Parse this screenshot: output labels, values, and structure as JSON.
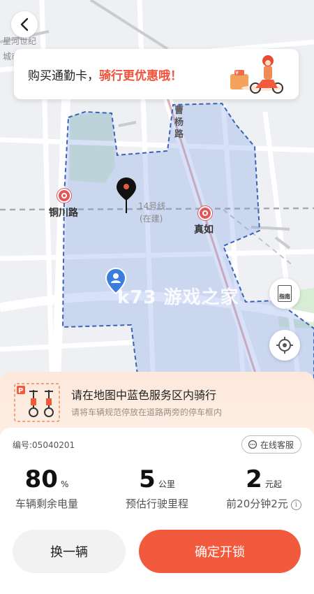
{
  "map": {
    "top_left_labels": [
      "星河世纪",
      "城市"
    ],
    "road_caoyang": "曹杨路",
    "station_tongchuan": "铜川路",
    "station_zhenru": "真如",
    "line14": "14号线",
    "line14_status": "(在建)",
    "watermark": "k73 游戏之家",
    "guide_label": "指南"
  },
  "promo": {
    "text_part1": "购买通勤卡，",
    "text_part2": "骑行更优惠哦！"
  },
  "notice": {
    "title": "请在地图中蓝色服务区内骑行",
    "subtitle": "请将车辆规范停放在道路两旁的停车框内"
  },
  "vehicle": {
    "id_label": "编号:05040201",
    "service_label": "在线客服"
  },
  "stats": {
    "battery": {
      "value": "80",
      "unit": "%",
      "label": "车辆剩余电量"
    },
    "distance": {
      "value": "5",
      "unit": "公里",
      "label": "预估行驶里程"
    },
    "price": {
      "value": "2",
      "unit": "元起",
      "label": "前20分钟2元"
    }
  },
  "actions": {
    "change_label": "换一辆",
    "unlock_label": "确定开锁"
  },
  "colors": {
    "accent": "#f25a3e",
    "service_area": "#3a63b8",
    "metro": "#e0575a"
  }
}
